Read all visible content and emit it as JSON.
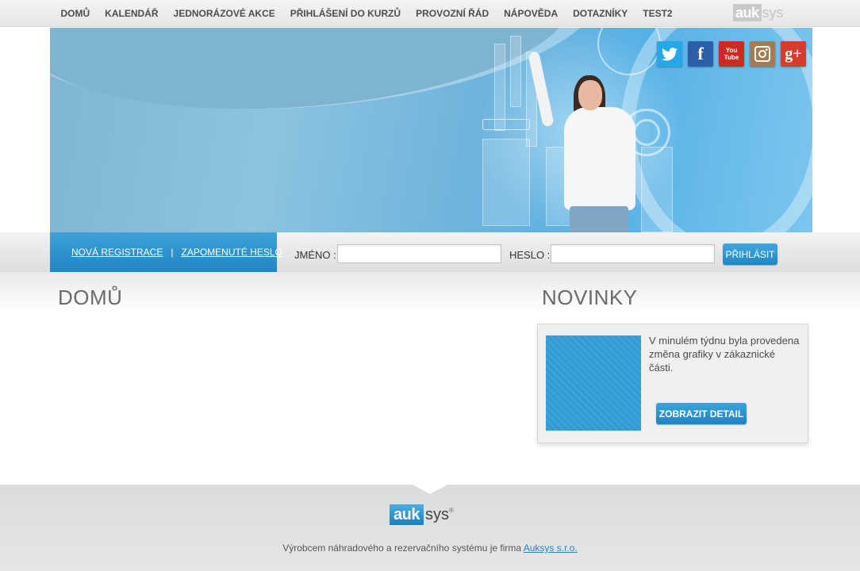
{
  "nav": {
    "items": [
      {
        "label": "DOMŮ"
      },
      {
        "label": "KALENDÁŘ"
      },
      {
        "label": "JEDNORÁZOVÉ AKCE"
      },
      {
        "label": "PŘIHLÁŠENÍ DO KURZŮ"
      },
      {
        "label": "PROVOZNÍ ŘÁD"
      },
      {
        "label": "NÁPOVĚDA"
      },
      {
        "label": "DOTAZNÍKY"
      },
      {
        "label": "TEST2"
      }
    ],
    "logo_part1": "auk",
    "logo_part2": "sys"
  },
  "social": {
    "twitter": "twitter-icon",
    "facebook": "facebook-icon",
    "youtube": "youtube-icon",
    "instagram": "instagram-icon",
    "googleplus": "google-plus-icon",
    "youtube_label": "You Tube",
    "googleplus_label": "g+"
  },
  "login": {
    "register_link": "NOVÁ REGISTRACE",
    "separator": "|",
    "forgot_link": "ZAPOMENUTÉ HESLO",
    "name_label": "JMÉNO :",
    "name_value": "",
    "password_label": "HESLO :",
    "password_value": "",
    "submit_label": "PŘIHLÁSIT"
  },
  "main": {
    "title": "DOMŮ"
  },
  "news": {
    "title": "NOVINKY",
    "items": [
      {
        "text": "V minulém týdnu byla provedena změna grafiky v zákaznické části.",
        "button_label": "ZOBRAZIT DETAIL"
      }
    ]
  },
  "footer": {
    "logo_part1": "auk",
    "logo_part2": "sys",
    "logo_mark": "®",
    "text": "Výrobcem náhradového a rezervačního systému je firma",
    "link": "Auksys s.r.o."
  },
  "colors": {
    "accent": "#1f86c2",
    "nav_text": "#4d4d4d",
    "heading": "#6b6b6b"
  }
}
